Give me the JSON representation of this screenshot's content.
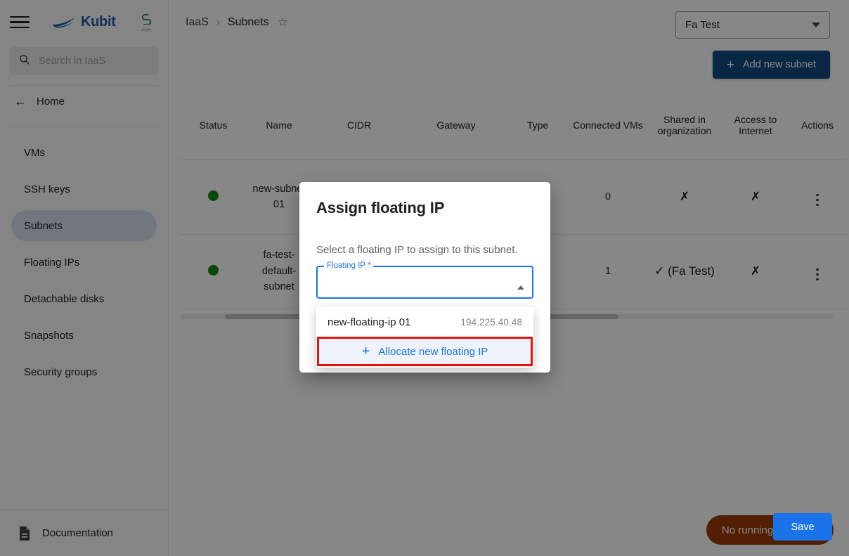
{
  "app": {
    "brand_name": "Kubit",
    "company_logo_glyph": "⚭",
    "company_logo_sub": "سازمان"
  },
  "sidebar": {
    "search_placeholder": "Search in IaaS",
    "search_value": "",
    "home_label": "Home",
    "items": [
      {
        "label": "VMs",
        "active": false
      },
      {
        "label": "SSH keys",
        "active": false
      },
      {
        "label": "Subnets",
        "active": true
      },
      {
        "label": "Floating IPs",
        "active": false
      },
      {
        "label": "Detachable disks",
        "active": false
      },
      {
        "label": "Snapshots",
        "active": false
      },
      {
        "label": "Security groups",
        "active": false
      }
    ],
    "documentation_label": "Documentation"
  },
  "header": {
    "breadcrumb_root": "IaaS",
    "breadcrumb_sep": "›",
    "breadcrumb_current": "Subnets",
    "favorite_icon": "☆",
    "project_selected": "Fa Test",
    "add_button_label": "Add new subnet",
    "add_button_plus": "+"
  },
  "table": {
    "columns": [
      "Status",
      "Name",
      "CIDR",
      "Gateway",
      "Type",
      "Connected VMs",
      "Shared in organization",
      "Access to Internet",
      "Actions"
    ],
    "rows": [
      {
        "status": "active",
        "name": "new-subnet 01",
        "cidr": "",
        "gateway": "",
        "type": "",
        "connected_vms": "0",
        "shared_in_organization": "✗",
        "access_to_internet": "✗",
        "actions": "kebab"
      },
      {
        "status": "active",
        "name": "fa-test-default-subnet",
        "cidr": "",
        "gateway": "",
        "type": "",
        "connected_vms": "1",
        "shared_in_organization": "✓ (Fa Test)",
        "access_to_internet": "✗",
        "actions": "kebab"
      }
    ]
  },
  "modal": {
    "title": "Assign floating IP",
    "description": "Select a floating IP to assign to this subnet.",
    "field_label": "Floating IP *",
    "field_value": "",
    "save_label": "Save"
  },
  "dropdown": {
    "options": [
      {
        "name": "new-floating-ip 01",
        "ip": "194.225.40.48"
      }
    ],
    "action_label": "Allocate new floating IP",
    "action_plus": "+"
  },
  "status_bar": {
    "jobs_label": "No running jobs"
  },
  "colors": {
    "brand_blue": "#1a5fa8",
    "primary_button": "#104a82",
    "accent_blue": "#1a73e8",
    "active_nav": "#d5dff0",
    "status_green": "#128a12",
    "jobs_orange": "#9c3b06",
    "highlight_red": "#e8130c"
  }
}
